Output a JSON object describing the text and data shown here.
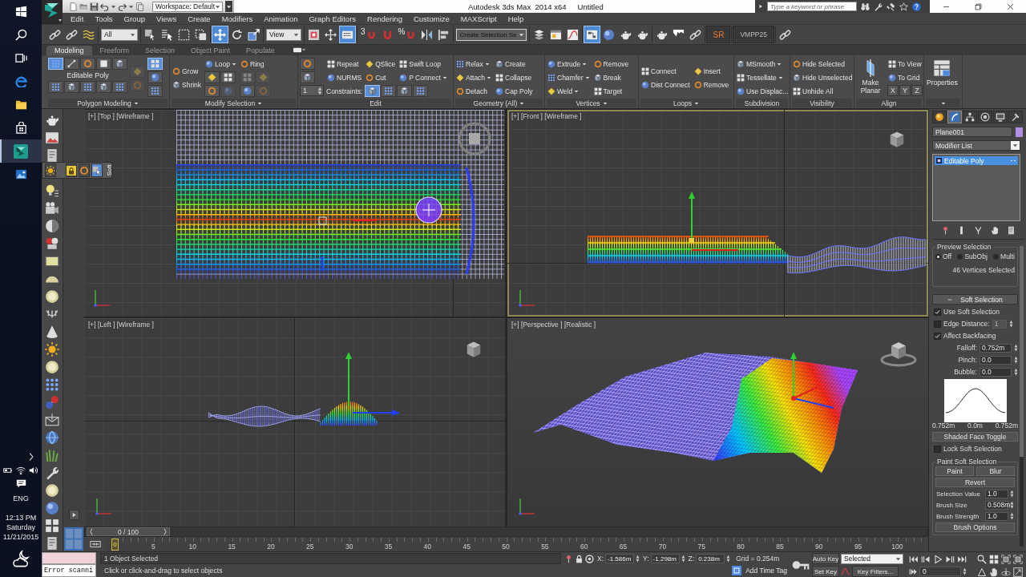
{
  "taskbar": {
    "apps": [
      {
        "kind": "start",
        "selected": false
      },
      {
        "kind": "search",
        "selected": false
      },
      {
        "kind": "task_view",
        "selected": false
      },
      {
        "kind": "browser",
        "selected": false
      },
      {
        "kind": "files",
        "selected": false
      },
      {
        "kind": "store",
        "selected": false
      },
      {
        "kind": "max",
        "selected": true
      },
      {
        "kind": "photos",
        "selected": false
      }
    ],
    "language": "ENG",
    "time": "12:13 PM",
    "day": "Saturday",
    "date": "11/21/2015"
  },
  "title_bar": {
    "workspace": "Workspace: Default",
    "app_title": "Autodesk 3ds Max  2014 x64",
    "document": "Untitled",
    "search": {
      "placeholder": "Type a keyword or phrase"
    }
  },
  "menu": [
    "Edit",
    "Tools",
    "Group",
    "Views",
    "Create",
    "Modifiers",
    "Animation",
    "Graph Editors",
    "Rendering",
    "Customize",
    "MAXScript",
    "Help"
  ],
  "main_toolbar": [
    {
      "kind": "icon",
      "selected": false
    },
    {
      "kind": "icon",
      "selected": false
    },
    {
      "kind": "icon",
      "selected": false
    },
    {
      "kind": "dropdown",
      "value": "All"
    },
    {
      "kind": "icon",
      "selected": false
    },
    {
      "kind": "icon",
      "selected": false
    },
    {
      "kind": "icon",
      "selected": false
    },
    {
      "kind": "icon",
      "selected": false
    },
    {
      "kind": "icon",
      "selected": true
    },
    {
      "kind": "icon",
      "selected": false
    },
    {
      "kind": "icon",
      "selected": false
    },
    {
      "kind": "dropdown",
      "value": "View"
    },
    {
      "kind": "icon",
      "selected": false
    },
    {
      "kind": "icon",
      "selected": false
    },
    {
      "kind": "icon",
      "selected": true
    },
    {
      "kind": "snap",
      "label": "3",
      "selected": false
    },
    {
      "kind": "icon",
      "selected": false
    },
    {
      "kind": "snap",
      "label": "%",
      "selected": false
    },
    {
      "kind": "icon",
      "selected": false
    },
    {
      "kind": "icon",
      "selected": false
    },
    {
      "kind": "dropdown",
      "value": "Create Selection Se"
    },
    {
      "kind": "icon",
      "selected": false
    },
    {
      "kind": "icon",
      "selected": false
    },
    {
      "kind": "icon",
      "selected": false
    },
    {
      "kind": "icon",
      "selected": true
    },
    {
      "kind": "icon",
      "selected": false
    },
    {
      "kind": "icon",
      "selected": false
    },
    {
      "kind": "icon",
      "selected": false
    },
    {
      "kind": "icon",
      "selected": false
    },
    {
      "kind": "icon",
      "selected": false
    },
    {
      "kind": "icon",
      "selected": false
    },
    {
      "kind": "text",
      "label": "SR"
    },
    {
      "kind": "text",
      "label": "VMPP25"
    },
    {
      "kind": "icon",
      "selected": false
    }
  ],
  "ribbon": {
    "tabs": [
      {
        "label": "Modeling",
        "selected": true
      },
      {
        "label": "Freeform",
        "selected": false
      },
      {
        "label": "Selection",
        "selected": false
      },
      {
        "label": "Object Paint",
        "selected": false
      },
      {
        "label": "Populate",
        "selected": false
      }
    ],
    "panels": [
      {
        "title": "Polygon Modeling",
        "menu": true,
        "columns": [
          [
            {
              "kind": "icon_row",
              "buttons": [
                {
                  "selected": true,
                  "disabled": false
                },
                {
                  "selected": false,
                  "disabled": false
                },
                {
                  "selected": false,
                  "disabled": false
                },
                {
                  "selected": false,
                  "disabled": false
                },
                {
                  "selected": false,
                  "disabled": false
                }
              ]
            },
            {
              "kind": "caption",
              "label": "Editable Poly"
            },
            {
              "kind": "icon_row",
              "buttons": [
                {
                  "selected": false,
                  "disabled": false
                },
                {
                  "selected": false,
                  "disabled": false
                },
                {
                  "selected": false,
                  "disabled": false
                },
                {
                  "selected": false,
                  "disabled": false
                },
                {
                  "selected": false,
                  "disabled": false
                }
              ]
            }
          ],
          [
            {
              "kind": "icon_row",
              "buttons": [
                {
                  "selected": false,
                  "disabled": true
                }
              ]
            },
            {
              "kind": "icon_row",
              "buttons": [
                {
                  "selected": false,
                  "disabled": true
                }
              ]
            }
          ],
          [
            {
              "kind": "icon_row",
              "buttons": [
                {
                  "selected": true,
                  "disabled": false
                }
              ]
            },
            {
              "kind": "icon_row",
              "buttons": [
                {
                  "selected": false,
                  "disabled": false
                }
              ]
            },
            {
              "kind": "icon_row",
              "buttons": [
                {
                  "selected": false,
                  "disabled": false
                }
              ]
            }
          ]
        ]
      },
      {
        "title": "Modify Selection",
        "menu": true,
        "columns": [
          [
            {
              "kind": "button",
              "label": "Grow",
              "dropdown": false
            },
            {
              "kind": "button",
              "label": "Shrink",
              "dropdown": false
            }
          ],
          [
            {
              "kind": "button",
              "label": "Loop",
              "dropdown": true
            },
            {
              "kind": "icon_row",
              "buttons": [
                {
                  "selected": false,
                  "disabled": false
                },
                {
                  "selected": false,
                  "disabled": false
                }
              ]
            },
            {
              "kind": "icon_row",
              "buttons": [
                {
                  "selected": false,
                  "disabled": false
                },
                {
                  "selected": false,
                  "disabled": true
                }
              ]
            }
          ],
          [
            {
              "kind": "button",
              "label": "Ring",
              "dropdown": false
            },
            {
              "kind": "icon_row",
              "buttons": [
                {
                  "selected": false,
                  "disabled": true
                },
                {
                  "selected": false,
                  "disabled": true
                }
              ]
            },
            {
              "kind": "icon_row",
              "buttons": [
                {
                  "selected": false,
                  "disabled": false
                },
                {
                  "selected": false,
                  "disabled": true
                }
              ]
            }
          ]
        ]
      },
      {
        "title": "Edit",
        "menu": false,
        "columns": [
          [
            {
              "kind": "icon_row",
              "buttons": [
                {
                  "selected": false,
                  "disabled": false
                }
              ]
            },
            {
              "kind": "icon_row",
              "buttons": [
                {
                  "selected": false,
                  "disabled": false
                }
              ]
            },
            {
              "kind": "spinner",
              "value": "1"
            }
          ],
          [
            {
              "kind": "button",
              "label": "Repeat",
              "dropdown": false
            },
            {
              "kind": "button",
              "label": "NURMS",
              "dropdown": false
            }
          ],
          [
            {
              "kind": "button",
              "label": "QSlice",
              "dropdown": false
            },
            {
              "kind": "button",
              "label": "Cut",
              "dropdown": false
            }
          ],
          [
            {
              "kind": "button",
              "label": "Swift Loop",
              "dropdown": false
            },
            {
              "kind": "button",
              "label": "P Connect",
              "dropdown": true
            }
          ]
        ],
        "bottom_row": {
          "label": "Constraints:",
          "buttons": [
            {
              "selected": true,
              "disabled": false
            },
            {
              "selected": false,
              "disabled": false
            },
            {
              "selected": false,
              "disabled": false
            },
            {
              "selected": false,
              "disabled": false
            }
          ]
        }
      },
      {
        "title": "Geometry (All)",
        "menu": true,
        "columns": [
          [
            {
              "kind": "button",
              "label": "Relax",
              "dropdown": true
            },
            {
              "kind": "button",
              "label": "Attach",
              "dropdown": true
            },
            {
              "kind": "button",
              "label": "Detach",
              "dropdown": false
            }
          ],
          [
            {
              "kind": "button",
              "label": "Create",
              "dropdown": false
            },
            {
              "kind": "button",
              "label": "Collapse",
              "dropdown": false
            },
            {
              "kind": "button",
              "label": "Cap Poly",
              "dropdown": false
            }
          ]
        ]
      },
      {
        "title": "Vertices",
        "menu": true,
        "columns": [
          [
            {
              "kind": "button",
              "label": "Extrude",
              "dropdown": true
            },
            {
              "kind": "button",
              "label": "Chamfer",
              "dropdown": true
            },
            {
              "kind": "button",
              "label": "Weld",
              "dropdown": true
            }
          ],
          [
            {
              "kind": "button",
              "label": "Remove",
              "dropdown": false
            },
            {
              "kind": "button",
              "label": "Break",
              "dropdown": false
            },
            {
              "kind": "button",
              "label": "Target",
              "dropdown": false
            }
          ]
        ]
      },
      {
        "title": "Loops",
        "menu": true,
        "columns": [
          [
            {
              "kind": "button",
              "label": "Connect",
              "dropdown": false
            },
            {
              "kind": "button",
              "label": "Dist Connect",
              "dropdown": false
            }
          ],
          [
            {
              "kind": "button",
              "label": "Insert",
              "dropdown": false
            },
            {
              "kind": "button",
              "label": "Remove",
              "dropdown": false
            }
          ]
        ]
      },
      {
        "title": "Subdivision",
        "menu": false,
        "columns": [
          [
            {
              "kind": "button",
              "label": "MSmooth",
              "dropdown": true
            },
            {
              "kind": "button",
              "label": "Tessellate",
              "dropdown": true
            },
            {
              "kind": "button",
              "label": "Use Displac...",
              "dropdown": false
            }
          ]
        ]
      },
      {
        "title": "Visibility",
        "menu": false,
        "columns": [
          [
            {
              "kind": "button",
              "label": "Hide Selected",
              "dropdown": false
            },
            {
              "kind": "button",
              "label": "Hide Unselected",
              "dropdown": false
            },
            {
              "kind": "button",
              "label": "Unhide All",
              "dropdown": false
            }
          ]
        ]
      },
      {
        "title": "Align",
        "menu": false,
        "columns": [
          [
            {
              "kind": "large",
              "label": "Make Planar"
            }
          ],
          [
            {
              "kind": "button",
              "label": "To View",
              "dropdown": false
            },
            {
              "kind": "button",
              "label": "To Grid",
              "dropdown": false
            },
            {
              "kind": "text_row",
              "labels": [
                "X",
                "Y",
                "Z"
              ]
            }
          ]
        ]
      },
      {
        "menu": true,
        "columns": [
          [
            {
              "kind": "large",
              "label": "Properties"
            }
          ]
        ]
      }
    ]
  },
  "left_toolbar": {
    "flyout": {
      "label": "Soft",
      "buttons": [
        {
          "selected": false
        },
        {
          "selected": false
        },
        {
          "selected": false
        },
        {
          "selected": true
        }
      ]
    }
  },
  "viewports": [
    {
      "kind": "top",
      "label": "[+] [Top ] [Wireframe ]",
      "selected": false
    },
    {
      "kind": "front",
      "label": "[+] [Front ] [Wireframe ]",
      "selected": true
    },
    {
      "kind": "left",
      "label": "[+] [Left ] [Wireframe ]",
      "selected": false
    },
    {
      "kind": "perspective",
      "label": "[+] [Perspective ] [Realistic ]",
      "selected": false
    }
  ],
  "command_panel": {
    "tabs": [
      {
        "selected": false
      },
      {
        "selected": true
      },
      {
        "selected": false
      },
      {
        "selected": false
      },
      {
        "selected": false
      },
      {
        "selected": false
      }
    ],
    "object_name": "Plane001",
    "modifier_list": "Modifier List",
    "stack": [
      {
        "label": "Editable Poly",
        "selected": true
      }
    ],
    "rollouts": [
      {
        "kind": "preview_selection",
        "title": "Preview Selection",
        "options": [
          {
            "label": "Off",
            "selected": true
          },
          {
            "label": "SubObj",
            "selected": false
          },
          {
            "label": "Multi",
            "selected": false
          }
        ],
        "status": "46 Vertices Selected"
      },
      {
        "kind": "soft_selection",
        "title": "Soft Selection",
        "expanded": true,
        "controls": [
          {
            "kind": "checkbox",
            "label": "Use Soft Selection",
            "checked": true
          },
          {
            "kind": "checkbox_spinner",
            "label": "Edge Distance:",
            "checked": false,
            "value": "1",
            "disabled": true
          },
          {
            "kind": "checkbox",
            "label": "Affect Backfacing",
            "checked": true
          },
          {
            "kind": "spinner",
            "label": "Falloff:",
            "value": "0.752m"
          },
          {
            "kind": "spinner",
            "label": "Pinch:",
            "value": "0.0"
          },
          {
            "kind": "spinner",
            "label": "Bubble:",
            "value": "0.0"
          },
          {
            "kind": "curve",
            "labels": [
              "0.752m",
              "0.0m",
              "0.752m"
            ]
          },
          {
            "kind": "button",
            "label": "Shaded Face Toggle"
          },
          {
            "kind": "checkbox",
            "label": "Lock Soft Selection",
            "checked": false
          },
          {
            "kind": "group",
            "title": "Paint Soft Selection",
            "controls": [
              {
                "kind": "button_pair",
                "labels": [
                  "Paint",
                  "Blur"
                ]
              },
              {
                "kind": "button",
                "label": "Revert"
              },
              {
                "kind": "spinner",
                "label": "Selection Value",
                "value": "1.0"
              },
              {
                "kind": "spinner",
                "label": "Brush Size",
                "value": "0.508m"
              },
              {
                "kind": "spinner",
                "label": "Brush Strength",
                "value": "1.0"
              },
              {
                "kind": "button",
                "label": "Brush Options"
              }
            ]
          }
        ]
      }
    ]
  },
  "timeline": {
    "slider": {
      "label": "0 / 100",
      "level": 0
    },
    "current_frame": "0",
    "ticks": [
      "5",
      "10",
      "15",
      "20",
      "25",
      "30",
      "35",
      "40",
      "45",
      "50",
      "55",
      "60",
      "65",
      "70",
      "75",
      "80",
      "85",
      "90",
      "95",
      "100"
    ]
  },
  "status_bar": {
    "listener_input": "Error scanni",
    "selection_status": "1 Object Selected",
    "prompt": "Click or click-and-drag to select objects",
    "coordinates": [
      {
        "axis": "X:",
        "value": "-1.586m"
      },
      {
        "axis": "Y:",
        "value": "-1.298m"
      },
      {
        "axis": "Z:",
        "value": "0.238m"
      }
    ],
    "grid": "Grid = 0.254m",
    "time_tag": "Add Time Tag",
    "auto_key": "Auto Key",
    "key_mode": "Selected",
    "set_key": "Set Key",
    "key_filters": "Key Filters...",
    "frame": "0"
  }
}
